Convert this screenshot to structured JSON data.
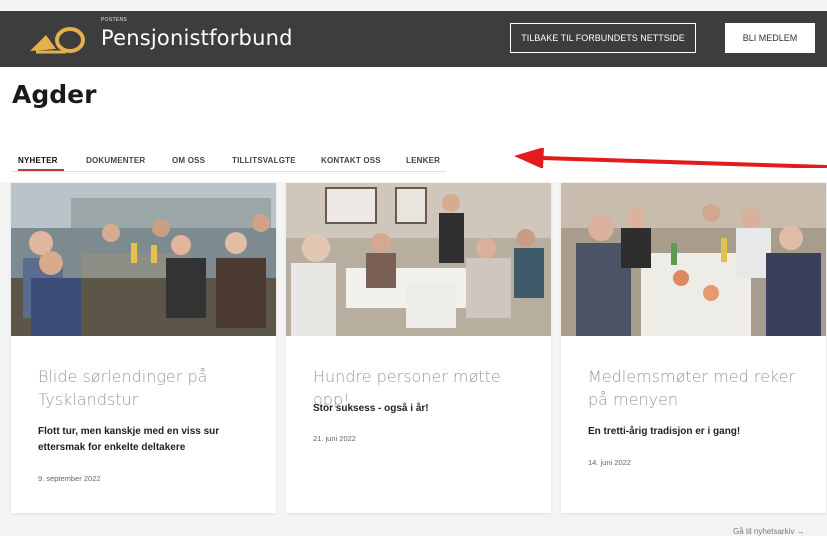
{
  "header": {
    "brand_small": "POSTENS",
    "brand_name": "Pensjonistforbund",
    "back_button": "TILBAKE TIL FORBUNDETS NETTSIDE",
    "join_button": "BLI MEDLEM",
    "colors": {
      "bar": "#3d3d3d",
      "logo": "#e3b04b"
    }
  },
  "page": {
    "title": "Agder"
  },
  "tabs": [
    {
      "label": "NYHETER",
      "active": true
    },
    {
      "label": "DOKUMENTER",
      "active": false
    },
    {
      "label": "OM OSS",
      "active": false
    },
    {
      "label": "TILLITSVALGTE",
      "active": false
    },
    {
      "label": "KONTAKT OSS",
      "active": false
    },
    {
      "label": "LENKER",
      "active": false
    }
  ],
  "annotation": {
    "arrow_color": "#e21b1b"
  },
  "news": [
    {
      "title": "Blide sørlendinger på Tysklandstur",
      "subtitle": "Flott tur, men kanskje med en viss sur ettersmak for enkelte deltakere",
      "date": "9. september 2022"
    },
    {
      "title": "Hundre personer møtte opp!",
      "subtitle": "Stor suksess - også i år!",
      "date": "21. juni 2022"
    },
    {
      "title": "Medlemsmøter med reker på menyen",
      "subtitle": "En tretti-årig tradisjon er i gang!",
      "date": "14. juni 2022"
    }
  ],
  "footer": {
    "more_link": "Gå til nyhetsarkiv →"
  }
}
